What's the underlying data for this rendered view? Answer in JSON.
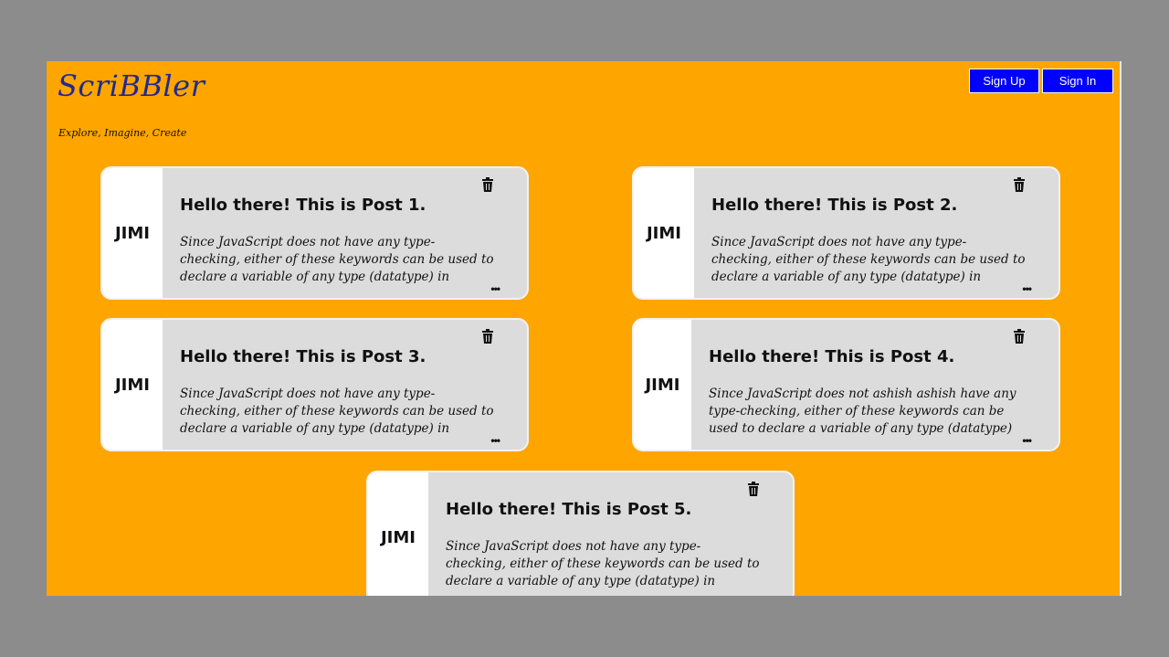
{
  "header": {
    "logo": "ScriBBler",
    "tagline": "Explore, Imagine, Create",
    "signup_label": "Sign Up",
    "signin_label": "Sign In"
  },
  "posts": [
    {
      "author": "JIMI",
      "title": "Hello there! This is Post 1.",
      "body": "Since JavaScript does not have any type-checking, either of these keywords can be used to declare a variable of any type (datatype) in JavaScript.",
      "more": "•••"
    },
    {
      "author": "JIMI",
      "title": "Hello there! This is Post 2.",
      "body": "Since JavaScript does not have any type-checking, either of these keywords can be used to declare a variable of any type (datatype) in JavaScript.",
      "more": "•••"
    },
    {
      "author": "JIMI",
      "title": "Hello there! This is Post 3.",
      "body": "Since JavaScript does not have any type-checking, either of these keywords can be used to declare a variable of any type (datatype) in JavaScript.",
      "more": "•••"
    },
    {
      "author": "JIMI",
      "title": "Hello there! This is Post 4.",
      "body": "Since JavaScript does not ashish ashish have any type-checking, either of these keywords can be used to declare a variable of any type (datatype) in",
      "more": "•••"
    },
    {
      "author": "JIMI",
      "title": "Hello there! This is Post 5.",
      "body": "Since JavaScript does not have any type-checking, either of these keywords can be used to declare a variable of any type (datatype) in JavaScript.",
      "more": ""
    }
  ],
  "colors": {
    "page_background": "#ffa500",
    "button": "#0000ff",
    "card": "#dcdcdc",
    "logo": "#1f2b8f"
  }
}
